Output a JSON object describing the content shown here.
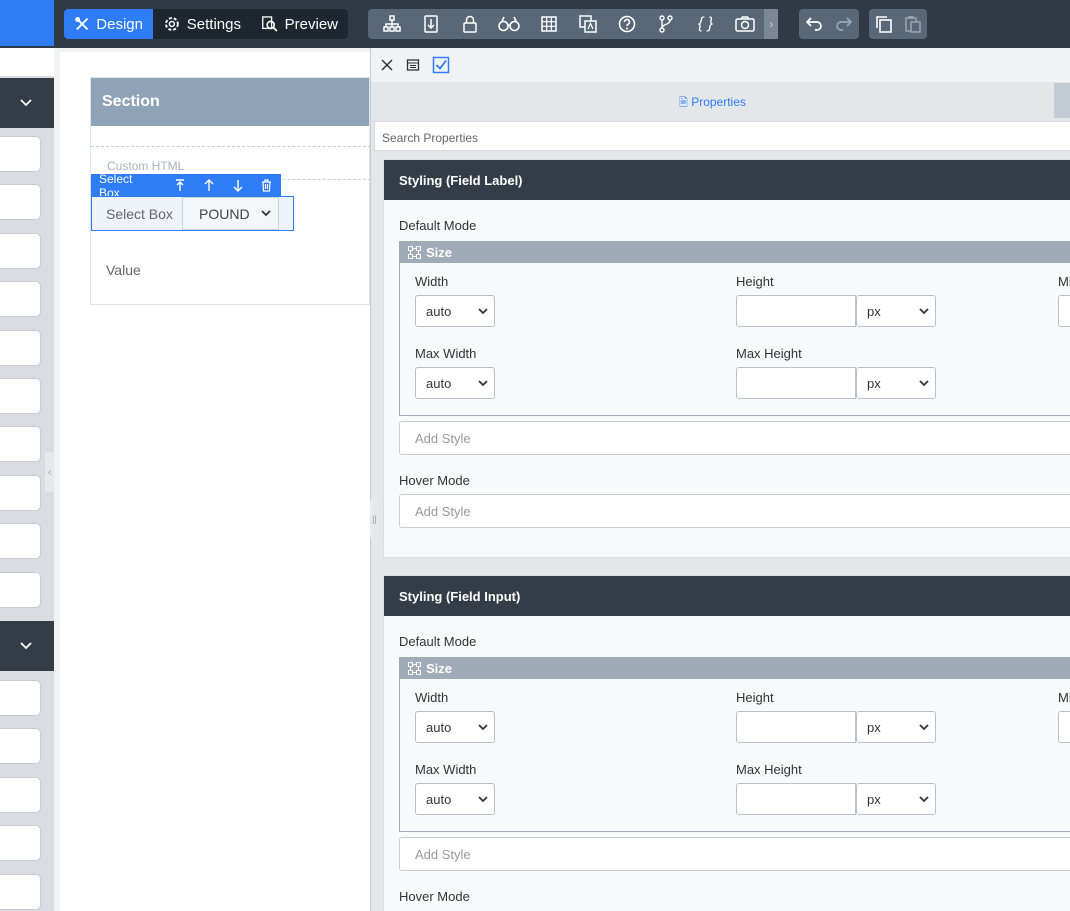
{
  "toolbar": {
    "design_label": "Design",
    "settings_label": "Settings",
    "preview_label": "Preview",
    "tools": [
      "sitemap-icon",
      "import-icon",
      "lock-icon",
      "binoculars-icon",
      "grid-icon",
      "translate-icon",
      "help-icon",
      "branch-icon",
      "code-braces-icon",
      "camera-icon"
    ]
  },
  "canvas": {
    "section_title": "Section",
    "custom_html_label": "Custom HTML",
    "select_toolbar_label": "Select Box",
    "select_label": "Select Box",
    "select_value": "POUND",
    "value_label": "Value"
  },
  "panel": {
    "tab_properties": "Properties",
    "search_placeholder": "Search Properties",
    "cards": [
      {
        "title": "Styling (Field Label)",
        "default_mode": "Default Mode",
        "size_title": "Size",
        "width_label": "Width",
        "width_value": "auto",
        "height_label": "Height",
        "height_unit": "px",
        "min_label": "Mi",
        "max_width_label": "Max Width",
        "max_width_value": "auto",
        "max_height_label": "Max Height",
        "max_height_unit": "px",
        "add_style": "Add Style",
        "hover_mode": "Hover Mode",
        "hover_add_style": "Add Style"
      },
      {
        "title": "Styling (Field Input)",
        "default_mode": "Default Mode",
        "size_title": "Size",
        "width_label": "Width",
        "width_value": "auto",
        "height_label": "Height",
        "height_unit": "px",
        "min_label": "Mi",
        "max_width_label": "Max Width",
        "max_width_value": "auto",
        "max_height_label": "Max Height",
        "max_height_unit": "px",
        "add_style": "Add Style",
        "hover_mode": "Hover Mode"
      }
    ]
  }
}
